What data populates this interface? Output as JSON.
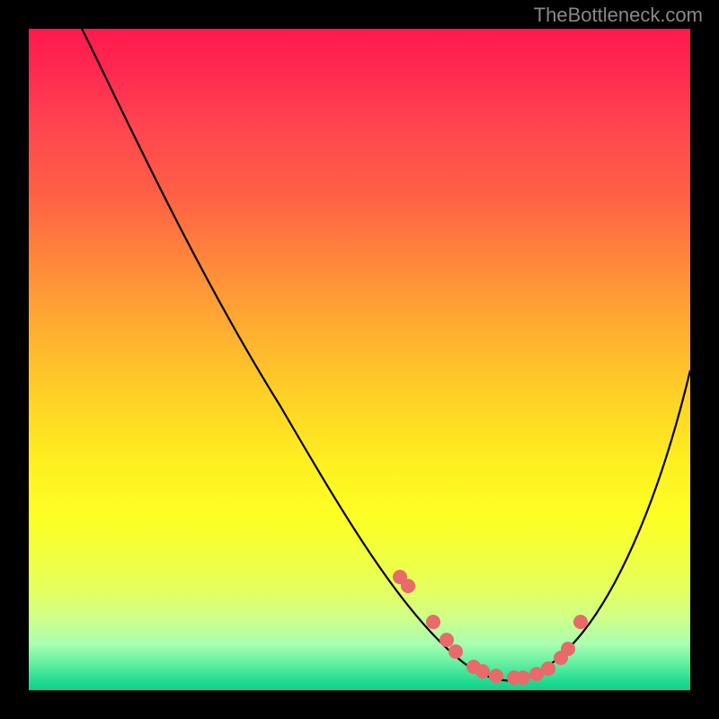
{
  "watermark": "TheBottleneck.com",
  "chart_data": {
    "type": "line",
    "title": "",
    "xlabel": "",
    "ylabel": "",
    "xlim": [
      0,
      100
    ],
    "ylim": [
      0,
      100
    ],
    "curve": {
      "x": [
        8,
        12,
        16,
        20,
        24,
        28,
        32,
        36,
        40,
        44,
        48,
        52,
        56,
        60,
        64,
        68,
        72,
        76,
        80,
        84,
        88,
        92,
        96,
        100
      ],
      "y": [
        100,
        93,
        86,
        79,
        72,
        65,
        58,
        51,
        44,
        37,
        30,
        23,
        18,
        12,
        7,
        4,
        2,
        2,
        5,
        11,
        20,
        31,
        42,
        52
      ]
    },
    "series": [
      {
        "name": "points",
        "x": [
          56,
          57,
          61,
          63,
          64,
          67,
          68,
          70,
          73,
          74,
          76,
          78,
          80,
          81,
          83
        ],
        "y": [
          18,
          17,
          11,
          9,
          7,
          4,
          4,
          3,
          2,
          2,
          3,
          4,
          6,
          8,
          12
        ]
      }
    ],
    "colors": {
      "curve": "#000000",
      "points": "#e86a6a",
      "gradient_top": "#ff1a4d",
      "gradient_bottom": "#10d088"
    }
  }
}
